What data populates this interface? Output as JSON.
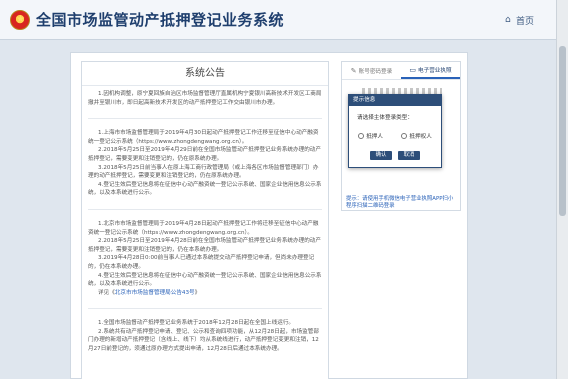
{
  "header": {
    "title": "全国市场监管动产抵押登记业务系统",
    "home_label": "首页"
  },
  "notice": {
    "title": "系统公告",
    "paragraphs": [
      "1.因机构调整，原宁夏回族自治区市场监督管理厅直属机构宁夏银川高新技术开发区工商局撤并至银川市，即日起高新技术开发区的动产抵押登记工作交由银川市办理。",
      "1.上海市市场监督管理局于2019年4月30日起动产抵押登记工作迁移至征信中心动产融资统一登记公示系统（https://www.zhongdengwang.org.cn）。",
      "2.2018年5月25日至2019年4月29日前在全国市场监管动产抵押登记业务系统办理的动产抵押登记，需要变更和注销登记的，仍在原系统办理。",
      "3.2018年5月25日前当事人在原上海工商行政管理局（或上海各区市场监督管理部门）办理的动产抵押登记，需要变更和注销登记的，仍在原系统办理。",
      "4.登记生效后登记信息将在征信中心动产融资统一登记公示系统、国家企业信用信息公示系统，以及本系统进行公示。",
      "1.北京市市场监督管理局于2019年4月28日起动产抵押登记工作将迁移至征信中心动产融资统一登记公示系统（https://www.zhongdengwang.org.cn）。",
      "2.2018年5月25日至2019年4月28日前在全国市场监管动产抵押登记业务系统办理的动产抵押登记，需要变更和注销登记的，仍在本系统办理。",
      "3.2019年4月28日0:00前当事人已通过本系统提交动产抵押登记申请，但尚未办理登记的，仍在本系统办理。",
      "4.登记生效后登记信息将在征信中心动产融资统一登记公示系统、国家企业信用信息公示系统，以及本系统进行公示。",
      "1.全国市场监督动产抵押登记业务系统于2018年12月28日起在全国上线运行。",
      "2.系统共有动产抵押登记申请、登记、公示和查询四项功能，从12月28日起，市场监管部门办理的新增动产抵押登记（含线上、线下）均从系统线进行，动产抵押登记变更和注销，12月27日前登记的，须通过原办理方式提出申请，12月28日后通过本系统办理。"
    ],
    "link_prefix": "详见《",
    "link_text": "北京市市场监督管理局公告43号",
    "link_suffix": "》"
  },
  "login": {
    "tab_account": "账号密码登录",
    "tab_license": "电子营业执照",
    "hint": "提示：请使用手机微信电子营业执照APP扫小程序扫描二维码登录"
  },
  "modal": {
    "title": "提示信息",
    "prompt": "请选择主体登录类型：",
    "option_mortgagor": "抵押人",
    "option_mortgagee": "抵押权人",
    "confirm": "确认",
    "cancel": "取消"
  }
}
